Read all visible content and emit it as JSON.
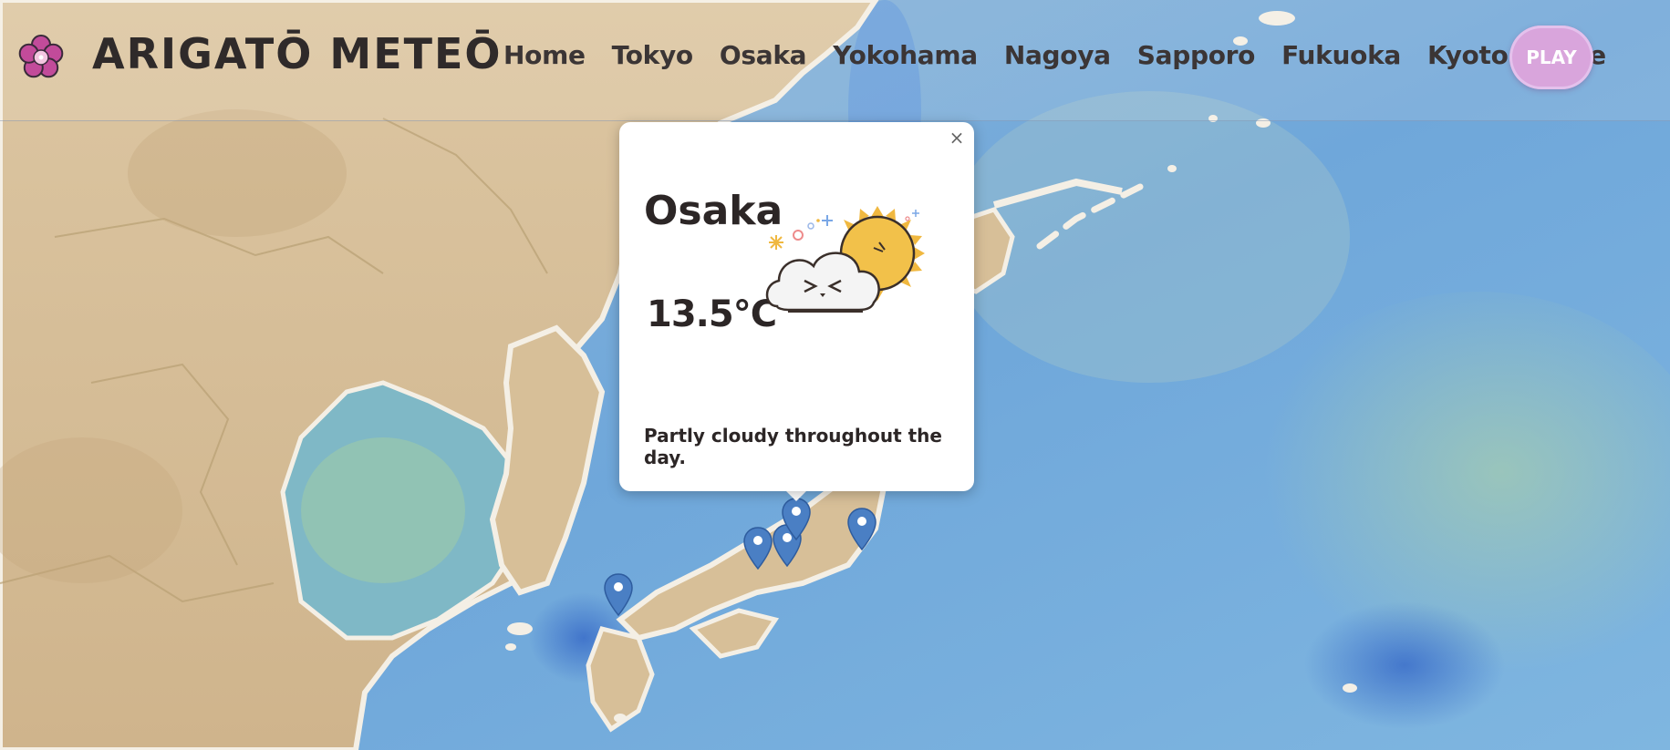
{
  "header": {
    "brand": "ARIGATŌ METEŌ",
    "nav": [
      "Home",
      "Tokyo",
      "Osaka",
      "Yokohama",
      "Nagoya",
      "Sapporo",
      "Fukuoka",
      "Kyoto",
      "Kobe"
    ],
    "play_label": "PLAY",
    "logo_icon": "sakura-flower-icon"
  },
  "popup": {
    "city": "Osaka",
    "temperature": "13.5°C",
    "description": "Partly cloudy throughout the day.",
    "close_symbol": "×",
    "illustration": "partly-cloudy-sun-cloud-icon"
  },
  "map": {
    "markers": [
      "fukuoka",
      "kobe",
      "osaka",
      "kyoto",
      "tokyo"
    ]
  },
  "colors": {
    "land": "#d8c09a",
    "sea": "#6aa8dc",
    "marker": "#4a7fc4",
    "play_button": "#d9a5dc",
    "text": "#2f2a2a"
  }
}
